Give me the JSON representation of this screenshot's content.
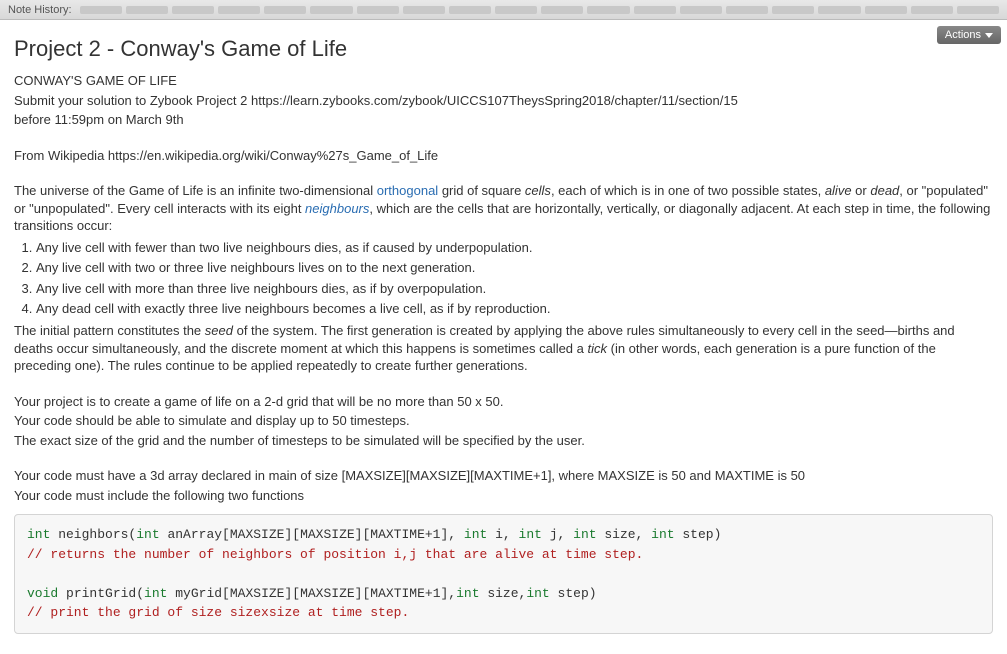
{
  "topbar": {
    "label": "Note History:"
  },
  "actions": {
    "label": "Actions"
  },
  "title": "Project 2 - Conway's Game of Life",
  "intro": {
    "subtitle": "CONWAY'S GAME OF LIFE",
    "submit_line": "Submit your solution to Zybook Project 2  https://learn.zybooks.com/zybook/UICCS107TheysSpring2018/chapter/11/section/15",
    "deadline": "before 11:59pm on March 9th",
    "wikipedia": "From Wikipedia https://en.wikipedia.org/wiki/Conway%27s_Game_of_Life"
  },
  "desc": {
    "p1a": "The universe of the Game of Life is an infinite two-dimensional ",
    "p1_link": "orthogonal",
    "p1b": " grid of square ",
    "p1_cells": "cells",
    "p1c": ", each of which is in one of two possible states, ",
    "p1_alive": "alive",
    "p1d": " or ",
    "p1_dead": "dead",
    "p1e": ", or \"populated\" or \"unpopulated\". Every cell interacts with its eight ",
    "p1_neighbours": "neighbours",
    "p1f": ", which are the cells that are horizontally, vertically, or diagonally adjacent. At each step in time, the following transitions occur:"
  },
  "rules": [
    "Any live cell with fewer than two live neighbours dies, as if caused by underpopulation.",
    "Any live cell with two or three live neighbours lives on to the next generation.",
    "Any live cell with more than three live neighbours dies, as if by overpopulation.",
    "Any dead cell with exactly three live neighbours becomes a live cell, as if by reproduction."
  ],
  "seed": {
    "a": "The initial pattern constitutes the ",
    "seed": "seed",
    "b": " of the system. The first generation is created by applying the above rules simultaneously to every cell in the seed—births and deaths occur simultaneously, and the discrete moment at which this happens is sometimes called a ",
    "tick": "tick",
    "c": " (in other words, each generation is a pure function of the preceding one). The rules continue to be applied repeatedly to create further generations."
  },
  "project": {
    "l1": "Your project is to create a game of life on a 2-d grid that will be no more than 50 x 50.",
    "l2": "Your code should be able to simulate and display up to 50 timesteps.",
    "l3": "The exact size of the grid and the number of timesteps to be simulated will be specified by the user."
  },
  "req": {
    "l1": "Your code must have a 3d array declared in main of size [MAXSIZE][MAXSIZE][MAXTIME+1], where MAXSIZE is 50 and MAXTIME is 50",
    "l2": "Your code must include the following two functions"
  },
  "code": {
    "sig1_a": "int",
    "sig1_b": " neighbors(",
    "sig1_c": "int",
    "sig1_d": " anArray[MAXSIZE][MAXSIZE][MAXTIME+1], ",
    "sig1_e": "int",
    "sig1_f": " i, ",
    "sig1_g": "int",
    "sig1_h": " j, ",
    "sig1_i": "int",
    "sig1_j": " size, ",
    "sig1_k": "int",
    "sig1_l": " step)",
    "comment1": "// returns the number of neighbors of position i,j that are alive at time step.",
    "sig2_a": "void",
    "sig2_b": " printGrid(",
    "sig2_c": "int",
    "sig2_d": " myGrid[MAXSIZE][MAXSIZE][MAXTIME+1],",
    "sig2_e": "int",
    "sig2_f": " size,",
    "sig2_g": "int",
    "sig2_h": " step)",
    "comment2": "// print the grid of size sizexsize at time step."
  }
}
